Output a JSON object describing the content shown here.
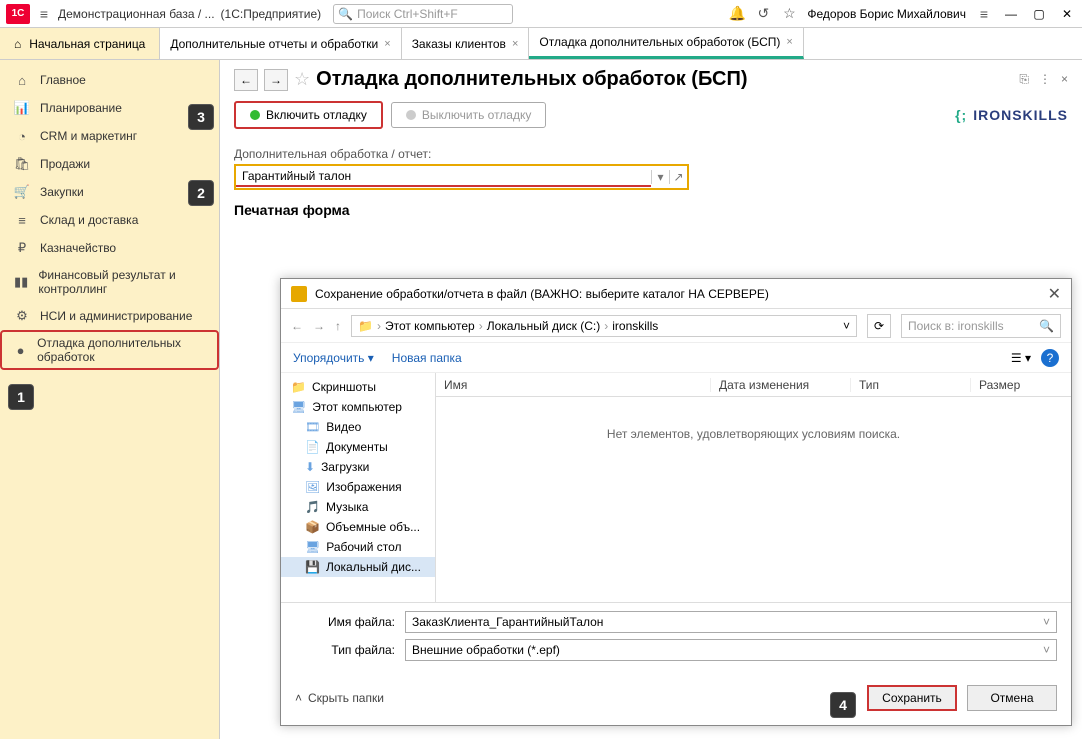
{
  "topbar": {
    "db_title": "Демонстрационная база / ...",
    "app_name": "(1С:Предприятие)",
    "search_placeholder": "Поиск Ctrl+Shift+F",
    "user": "Федоров Борис Михайлович"
  },
  "tabs": {
    "home": "Начальная страница",
    "items": [
      {
        "label": "Дополнительные отчеты и обработки"
      },
      {
        "label": "Заказы клиентов"
      },
      {
        "label": "Отладка дополнительных обработок (БСП)"
      }
    ]
  },
  "sidebar": {
    "items": [
      {
        "icon": "⌂",
        "label": "Главное"
      },
      {
        "icon": "📊",
        "label": "Планирование"
      },
      {
        "icon": "◔",
        "label": "CRM и маркетинг"
      },
      {
        "icon": "🛍",
        "label": "Продажи"
      },
      {
        "icon": "🛒",
        "label": "Закупки"
      },
      {
        "icon": "≡",
        "label": "Склад и доставка"
      },
      {
        "icon": "₽",
        "label": "Казначейство"
      },
      {
        "icon": "▮▮",
        "label": "Финансовый результат и контроллинг"
      },
      {
        "icon": "⚙",
        "label": "НСИ и администрирование"
      },
      {
        "icon": "●",
        "label": "Отладка дополнительных обработок"
      }
    ]
  },
  "main": {
    "title": "Отладка дополнительных обработок (БСП)",
    "btn_enable": "Включить отладку",
    "btn_disable": "Выключить отладку",
    "logo": "IRONSKILLS",
    "field_label": "Дополнительная обработка / отчет:",
    "field_value": "Гарантийный талон",
    "print_label": "Печатная форма"
  },
  "dialog": {
    "title": "Сохранение обработки/отчета в файл (ВАЖНО: выберите каталог НА СЕРВЕРЕ)",
    "breadcrumb": [
      "Этот компьютер",
      "Локальный диск (C:)",
      "ironskills"
    ],
    "search_placeholder": "Поиск в: ironskills",
    "organize": "Упорядочить",
    "new_folder": "Новая папка",
    "cols": {
      "name": "Имя",
      "date": "Дата изменения",
      "type": "Тип",
      "size": "Размер"
    },
    "empty": "Нет элементов, удовлетворяющих условиям поиска.",
    "tree": [
      {
        "icon": "📁",
        "label": "Скриншоты"
      },
      {
        "icon": "🖥",
        "label": "Этот компьютер"
      },
      {
        "icon": "🎞",
        "label": "Видео",
        "indent": true
      },
      {
        "icon": "📄",
        "label": "Документы",
        "indent": true
      },
      {
        "icon": "⬇",
        "label": "Загрузки",
        "indent": true
      },
      {
        "icon": "🖼",
        "label": "Изображения",
        "indent": true
      },
      {
        "icon": "🎵",
        "label": "Музыка",
        "indent": true
      },
      {
        "icon": "📦",
        "label": "Объемные объ...",
        "indent": true
      },
      {
        "icon": "🖥",
        "label": "Рабочий стол",
        "indent": true
      },
      {
        "icon": "💾",
        "label": "Локальный дис...",
        "indent": true,
        "sel": true
      }
    ],
    "filename_label": "Имя файла:",
    "filename": "ЗаказКлиента_ГарантийныйТалон",
    "filetype_label": "Тип файла:",
    "filetype": "Внешние обработки (*.epf)",
    "hide_folders": "Скрыть папки",
    "save": "Сохранить",
    "cancel": "Отмена"
  },
  "steps": {
    "1": "1",
    "2": "2",
    "3": "3",
    "4": "4"
  }
}
